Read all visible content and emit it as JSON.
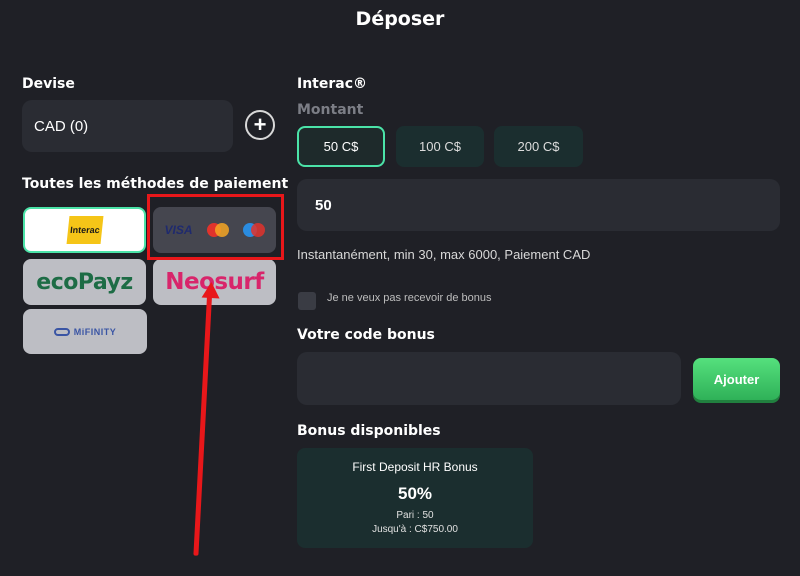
{
  "page": {
    "title": "Déposer"
  },
  "currency": {
    "label": "Devise",
    "value": "CAD (0)",
    "add_symbol": "+"
  },
  "methods": {
    "label": "Toutes les méthodes de paiement",
    "interac_logo": "Interac",
    "visa_logo": "VISA",
    "ecopayz_logo": "ecoPayz",
    "neosurf_logo": "Neosurf",
    "mifinity_logo": "MiFINITY"
  },
  "deposit": {
    "method_name": "Interac®",
    "amount_label": "Montant",
    "amounts": [
      "50 C$",
      "100 C$",
      "200 C$"
    ],
    "amount_value": "50",
    "info": "Instantanément, min 30, max 6000, Paiement CAD",
    "no_bonus_label": "Je ne veux pas recevoir de bonus"
  },
  "bonus_code": {
    "label": "Votre code bonus",
    "button": "Ajouter"
  },
  "bonuses": {
    "label": "Bonus disponibles",
    "card": {
      "name": "First Deposit HR Bonus",
      "percent": "50%",
      "wager": "Pari : 50",
      "max": "Jusqu'à : C$750.00"
    }
  },
  "colors": {
    "accent": "#4be3a8",
    "highlight": "#e8171a",
    "button_green": "#3cc768"
  }
}
